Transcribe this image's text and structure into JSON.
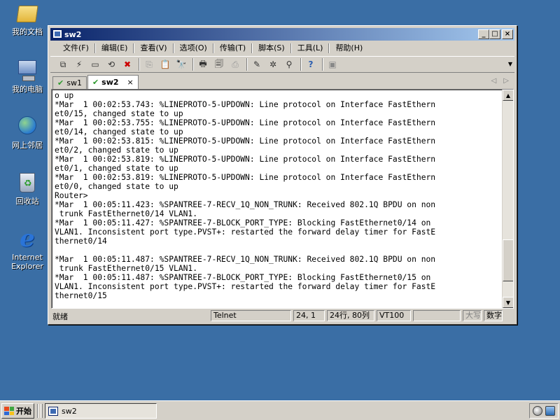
{
  "desktop": {
    "icons": [
      {
        "label": "我的文档"
      },
      {
        "label": "我的电脑"
      },
      {
        "label": "网上邻居"
      },
      {
        "label": "回收站"
      },
      {
        "label_line1": "Internet",
        "label_line2": "Explorer"
      }
    ]
  },
  "window": {
    "title": "sw2",
    "controls": {
      "minimize": "_",
      "maximize": "□",
      "close": "×"
    },
    "menu": [
      "文件(F)",
      "编辑(E)",
      "查看(V)",
      "选项(O)",
      "传输(T)",
      "脚本(S)",
      "工具(L)",
      "帮助(H)"
    ],
    "tabs": [
      {
        "label": "sw1",
        "active": false
      },
      {
        "label": "sw2",
        "active": true
      }
    ],
    "tab_close": "×",
    "terminal_lines": [
      "o up",
      "*Mar  1 00:02:53.743: %LINEPROTO-5-UPDOWN: Line protocol on Interface FastEthern",
      "et0/15, changed state to up",
      "*Mar  1 00:02:53.755: %LINEPROTO-5-UPDOWN: Line protocol on Interface FastEthern",
      "et0/14, changed state to up",
      "*Mar  1 00:02:53.815: %LINEPROTO-5-UPDOWN: Line protocol on Interface FastEthern",
      "et0/2, changed state to up",
      "*Mar  1 00:02:53.819: %LINEPROTO-5-UPDOWN: Line protocol on Interface FastEthern",
      "et0/1, changed state to up",
      "*Mar  1 00:02:53.819: %LINEPROTO-5-UPDOWN: Line protocol on Interface FastEthern",
      "et0/0, changed state to up",
      "Router>",
      "*Mar  1 00:05:11.423: %SPANTREE-7-RECV_1Q_NON_TRUNK: Received 802.1Q BPDU on non",
      " trunk FastEthernet0/14 VLAN1.",
      "*Mar  1 00:05:11.427: %SPANTREE-7-BLOCK_PORT_TYPE: Blocking FastEthernet0/14 on",
      "VLAN1. Inconsistent port type.PVST+: restarted the forward delay timer for FastE",
      "thernet0/14",
      "",
      "*Mar  1 00:05:11.487: %SPANTREE-7-RECV_1Q_NON_TRUNK: Received 802.1Q BPDU on non",
      " trunk FastEthernet0/15 VLAN1.",
      "*Mar  1 00:05:11.487: %SPANTREE-7-BLOCK_PORT_TYPE: Blocking FastEthernet0/15 on",
      "VLAN1. Inconsistent port type.PVST+: restarted the forward delay timer for FastE",
      "thernet0/15"
    ],
    "status": {
      "ready": "就绪",
      "protocol": "Telnet",
      "cursor": "24, 1",
      "size": "24行, 80列",
      "emulation": "VT100",
      "caps": "大写",
      "num": "数字"
    },
    "scroll_position": 0.9
  },
  "taskbar": {
    "start_label": "开始",
    "task_label": "sw2"
  }
}
